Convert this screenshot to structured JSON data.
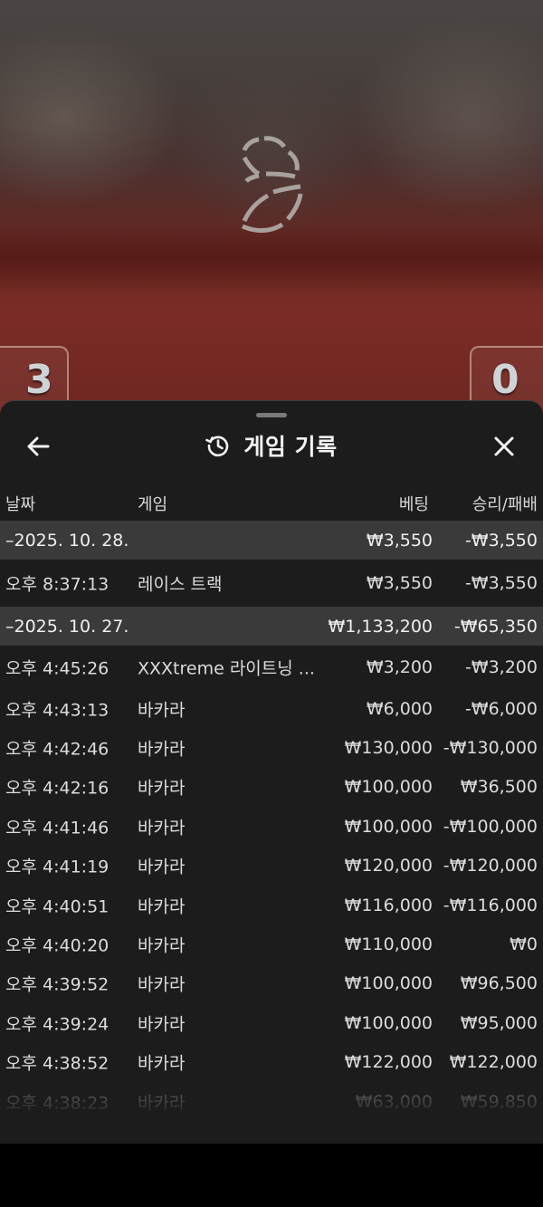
{
  "game": {
    "score_left": "3",
    "score_right": "0"
  },
  "sheet": {
    "title": "게임 기록",
    "icons": {
      "back": "arrow-left-icon",
      "history": "history-icon",
      "close": "close-icon"
    },
    "columns": {
      "date": "날짜",
      "game": "게임",
      "bet": "베팅",
      "result": "승리/패배"
    },
    "groups": [
      {
        "date": "–2025. 10. 28.",
        "bet": "₩3,550",
        "result": "-₩3,550",
        "entries": [
          {
            "time": "오후 8:37:13",
            "game": "레이스 트랙",
            "bet": "₩3,550",
            "result": "-₩3,550"
          }
        ]
      },
      {
        "date": "–2025. 10. 27.",
        "bet": "₩1,133,200",
        "result": "-₩65,350",
        "entries": [
          {
            "time": "오후 4:45:26",
            "game": "XXXtreme 라이트닝 ...",
            "bet": "₩3,200",
            "result": "-₩3,200"
          },
          {
            "time": "오후 4:43:13",
            "game": "바카라",
            "bet": "₩6,000",
            "result": "-₩6,000"
          },
          {
            "time": "오후 4:42:46",
            "game": "바카라",
            "bet": "₩130,000",
            "result": "-₩130,000"
          },
          {
            "time": "오후 4:42:16",
            "game": "바카라",
            "bet": "₩100,000",
            "result": "₩36,500"
          },
          {
            "time": "오후 4:41:46",
            "game": "바카라",
            "bet": "₩100,000",
            "result": "-₩100,000"
          },
          {
            "time": "오후 4:41:19",
            "game": "바카라",
            "bet": "₩120,000",
            "result": "-₩120,000"
          },
          {
            "time": "오후 4:40:51",
            "game": "바카라",
            "bet": "₩116,000",
            "result": "-₩116,000"
          },
          {
            "time": "오후 4:40:20",
            "game": "바카라",
            "bet": "₩110,000",
            "result": "₩0"
          },
          {
            "time": "오후 4:39:52",
            "game": "바카라",
            "bet": "₩100,000",
            "result": "₩96,500"
          },
          {
            "time": "오후 4:39:24",
            "game": "바카라",
            "bet": "₩100,000",
            "result": "₩95,000"
          },
          {
            "time": "오후 4:38:52",
            "game": "바카라",
            "bet": "₩122,000",
            "result": "₩122,000"
          },
          {
            "time": "오후 4:38:23",
            "game": "바카라",
            "bet": "₩63,000",
            "result": "₩59,850"
          }
        ]
      }
    ]
  },
  "colors": {
    "sheet_bg": "#1c1c1c",
    "group_row_bg": "#3a3a3a",
    "text": "#dcdcdc"
  }
}
